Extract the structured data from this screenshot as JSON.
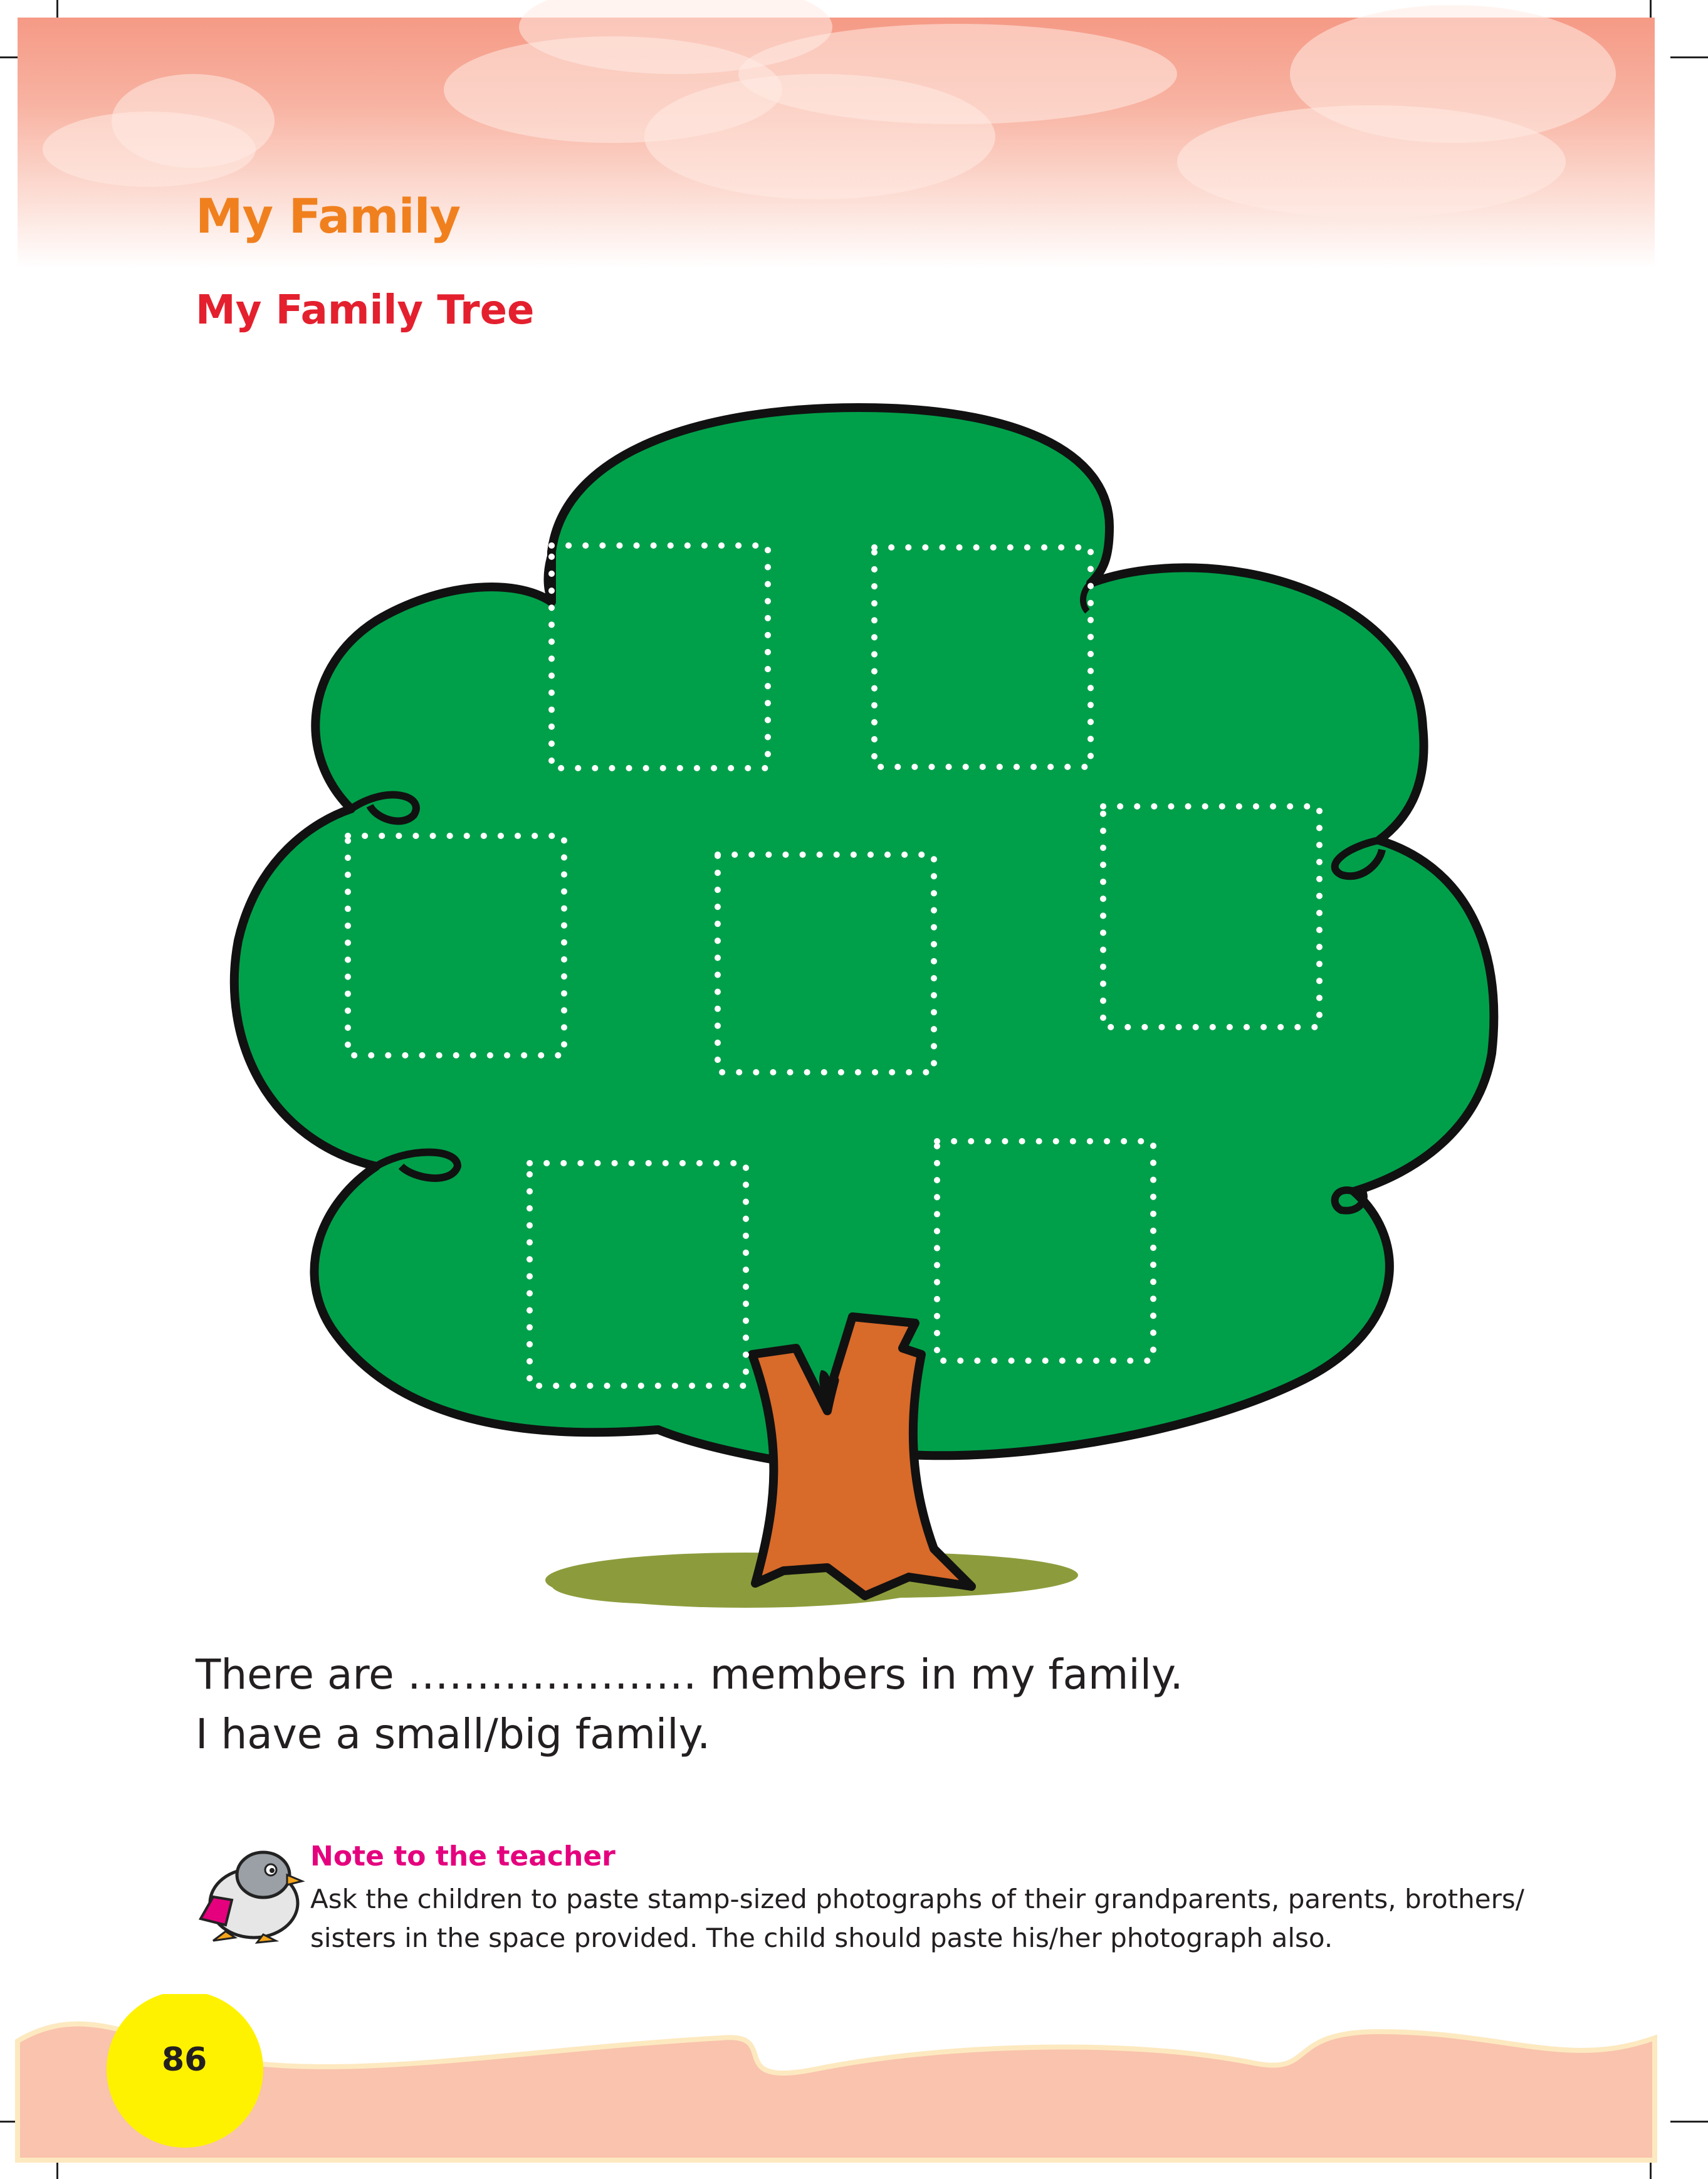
{
  "header": {
    "title": "My Family",
    "subtitle": "My Family Tree"
  },
  "activity": {
    "sentence_1": "There are ………………… members in my family.",
    "sentence_2": "I have a small/big family."
  },
  "teacher_note": {
    "heading": "Note to the teacher",
    "text_line_1": "Ask the children to paste stamp-sized photographs of their grandparents, parents, brothers/",
    "text_line_2": "sisters in the space provided. The child should paste his/her photograph also."
  },
  "footer": {
    "page_number": "86"
  },
  "colors": {
    "title": "#f0801e",
    "subtitle": "#e4202e",
    "note_heading": "#e5007e",
    "tree_foliage": "#00a04a",
    "tree_trunk": "#d86a2a",
    "grass": "#8c9c3c",
    "page_number_circle": "#fff200",
    "footer_band": "#f9c3ad"
  },
  "icons": {
    "mascot": "penguin-with-book-icon",
    "photo_frames": "dotted-square-frame-icon"
  }
}
